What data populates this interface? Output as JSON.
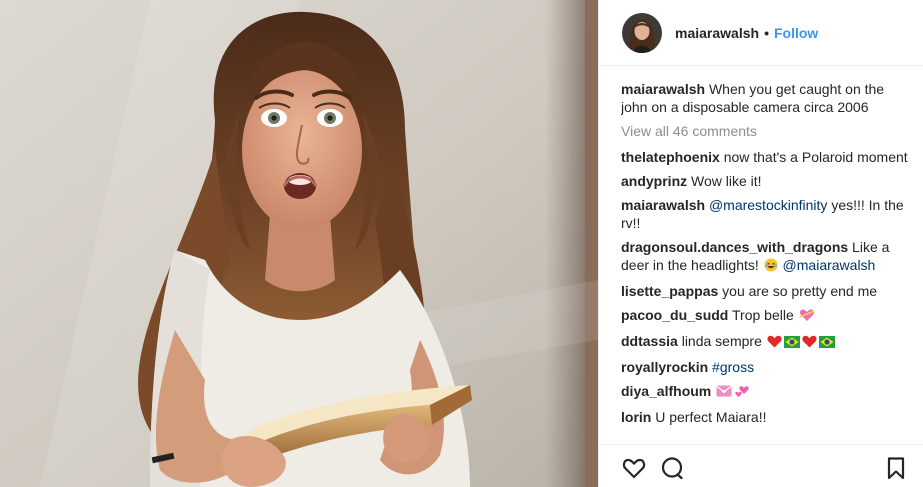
{
  "header": {
    "username": "maiarawalsh",
    "separator": "•",
    "follow_label": "Follow"
  },
  "caption": {
    "username": "maiarawalsh",
    "text": "When you get caught on the john on a disposable camera circa 2006"
  },
  "view_all_comments": "View all 46 comments",
  "comments": [
    {
      "username": "thelatephoenix",
      "text": "now that's a Polaroid moment"
    },
    {
      "username": "andyprinz",
      "text": "Wow like it!"
    },
    {
      "username": "maiarawalsh",
      "mention": "@marestockinfinity",
      "text": "yes!!! In the rv!!"
    },
    {
      "username": "dragonsoul.dances_with_dragons",
      "text": "Like a deer in the headlights!",
      "emoji": "tears-of-joy",
      "mention": "@maiarawalsh"
    },
    {
      "username": "lisette_pappas",
      "text": "you are so pretty end me"
    },
    {
      "username": "pacoo_du_sudd",
      "text": "Trop belle",
      "emoji": "heart-with-ribbon"
    },
    {
      "username": "ddtassia",
      "text": "linda sempre",
      "emoji": "red-heart brazil-flag red-heart brazil-flag"
    },
    {
      "username": "royallyrockin",
      "hashtag": "#gross"
    },
    {
      "username": "diya_alfhoum",
      "emoji": "love-letter two-hearts"
    },
    {
      "username": "lorin",
      "text": "U perfect Maiara!!"
    }
  ],
  "actions": {
    "like": "heart-icon",
    "comment": "comment-icon",
    "save": "bookmark-icon"
  },
  "colors": {
    "link_blue": "#3897f0",
    "mention_navy": "#003569",
    "muted_gray": "#8e8e8e",
    "text": "#262626",
    "divider": "#efefef"
  }
}
